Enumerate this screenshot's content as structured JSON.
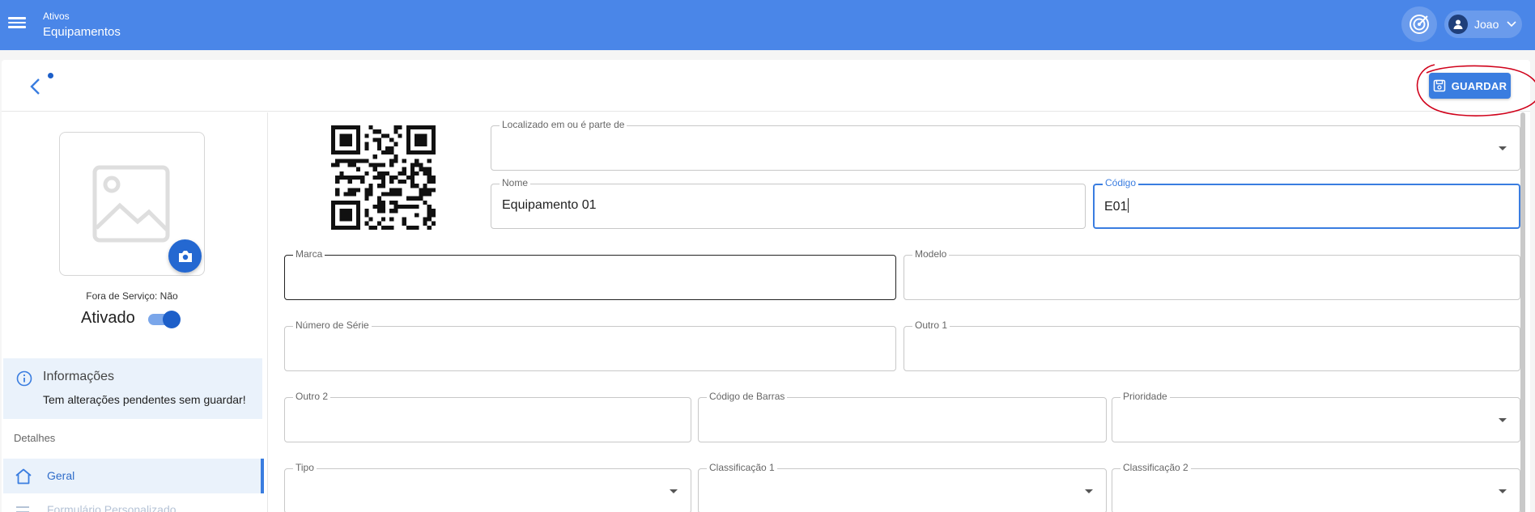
{
  "topbar": {
    "breadcrumb": "Ativos",
    "title": "Equipamentos",
    "user_name": "Joao",
    "bg_color": "#4a86e8"
  },
  "toolbar": {
    "save_label": "GUARDAR"
  },
  "sidebar": {
    "out_of_service_text": "Fora de Serviço: Não",
    "active_label": "Ativado",
    "active_on": true,
    "info_title": "Informações",
    "info_message": "Tem alterações pendentes sem guardar!",
    "section_label": "Detalhes",
    "nav": [
      {
        "label": "Geral",
        "icon": "home-icon",
        "selected": true
      },
      {
        "label": "Formulário Personalizado",
        "icon": "list-icon",
        "selected": false
      }
    ]
  },
  "form": {
    "located_in": {
      "label": "Localizado em ou é parte de",
      "value": ""
    },
    "name": {
      "label": "Nome",
      "value": "Equipamento 01"
    },
    "code": {
      "label": "Código",
      "value": "E01"
    },
    "brand": {
      "label": "Marca",
      "value": ""
    },
    "model": {
      "label": "Modelo",
      "value": ""
    },
    "serial": {
      "label": "Número de Série",
      "value": ""
    },
    "other1": {
      "label": "Outro 1",
      "value": ""
    },
    "other2": {
      "label": "Outro 2",
      "value": ""
    },
    "barcode": {
      "label": "Código de Barras",
      "value": ""
    },
    "priority": {
      "label": "Prioridade",
      "value": ""
    },
    "type": {
      "label": "Tipo",
      "value": ""
    },
    "class1": {
      "label": "Classificação 1",
      "value": ""
    },
    "class2": {
      "label": "Classificação 2",
      "value": ""
    }
  },
  "colors": {
    "accent": "#3a7de0",
    "highlight_circle": "#d0021b"
  }
}
